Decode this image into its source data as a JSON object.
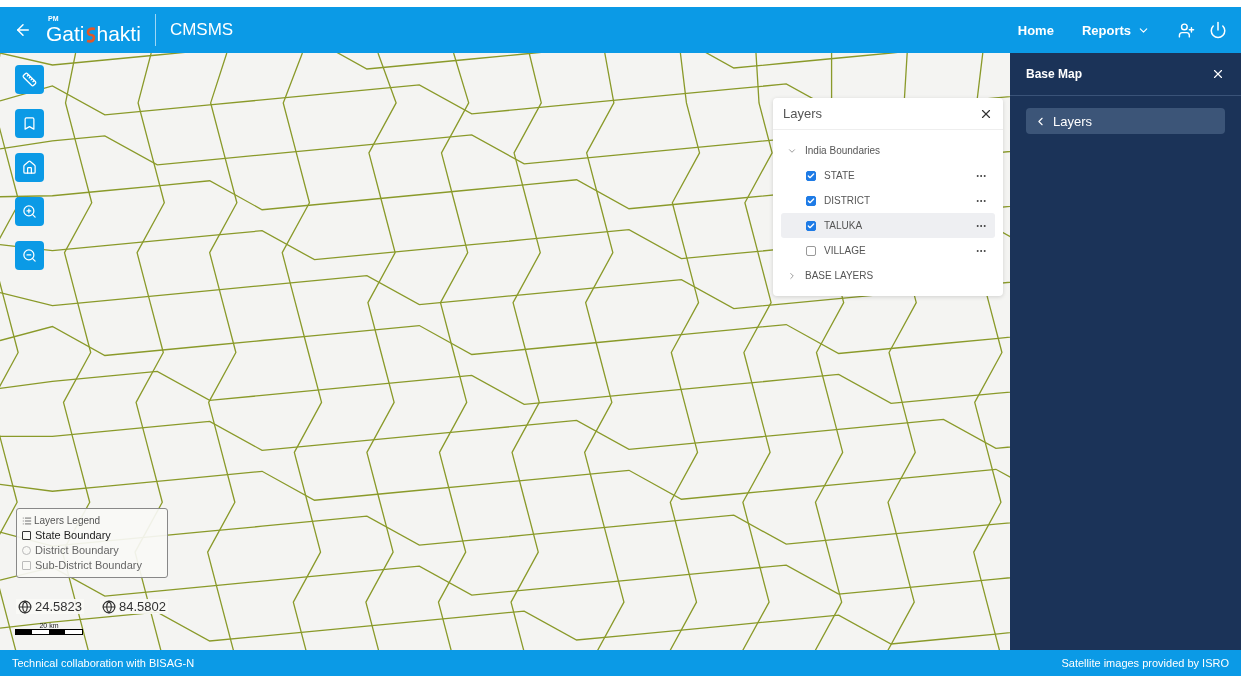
{
  "header": {
    "logo": {
      "prefix": "PM",
      "word_1": "Gati",
      "word_2": "hakti"
    },
    "app_name": "CMSMS",
    "nav": [
      {
        "label": "Home",
        "has_menu": false
      },
      {
        "label": "Reports",
        "has_menu": true
      }
    ]
  },
  "map_tools": [
    {
      "kind": "measure"
    },
    {
      "kind": "bookmark"
    },
    {
      "kind": "home"
    },
    {
      "kind": "zoom_in"
    },
    {
      "kind": "zoom_out"
    }
  ],
  "layers_panel": {
    "title": "Layers",
    "groups": [
      {
        "label": "India Boundaries",
        "expanded": true,
        "children": [
          {
            "label": "STATE",
            "checked": true,
            "selected": false
          },
          {
            "label": "DISTRICT",
            "checked": true,
            "selected": false
          },
          {
            "label": "TALUKA",
            "checked": true,
            "selected": true
          },
          {
            "label": "VILLAGE",
            "checked": false,
            "selected": false
          }
        ]
      },
      {
        "label": "BASE LAYERS",
        "expanded": false
      }
    ]
  },
  "legend": {
    "title": "Layers Legend",
    "items": [
      {
        "label": "State Boundary",
        "kind": "square",
        "faded": false
      },
      {
        "label": "District Boundary",
        "kind": "circle",
        "faded": true
      },
      {
        "label": "Sub-District Boundary",
        "kind": "square",
        "faded": true
      }
    ]
  },
  "coordinates": {
    "latitude": "24.5823",
    "longitude": "84.5802"
  },
  "scale": {
    "label": "20 km"
  },
  "side_panel": {
    "title": "Base Map",
    "back_button": "Layers"
  },
  "footer": {
    "left": "Technical collaboration with BISAG-N",
    "right": "Satellite images provided by ISRO"
  }
}
